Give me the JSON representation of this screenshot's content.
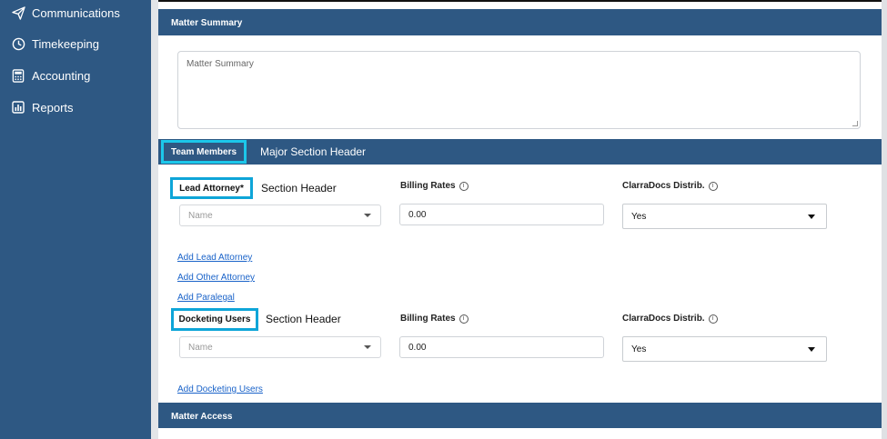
{
  "sidebar": {
    "items": [
      {
        "label": "Communications",
        "icon": "paper-plane-icon"
      },
      {
        "label": "Timekeeping",
        "icon": "clock-icon"
      },
      {
        "label": "Accounting",
        "icon": "calculator-icon"
      },
      {
        "label": "Reports",
        "icon": "bar-chart-icon"
      }
    ]
  },
  "matter_summary": {
    "title": "Matter Summary",
    "placeholder": "Matter Summary"
  },
  "team_members": {
    "title": "Team Members",
    "major_header": "Major Section Header",
    "lead": {
      "box_label": "Lead Attorney*",
      "section_header": "Section Header",
      "name_placeholder": "Name",
      "billing_label": "Billing Rates",
      "billing_value": "0.00",
      "distrib_label": "ClarraDocs Distrib.",
      "distrib_value": "Yes"
    },
    "links": [
      "Add Lead Attorney",
      "Add Other Attorney",
      "Add Paralegal"
    ],
    "docketing": {
      "box_label": "Docketing Users",
      "section_header": "Section Header",
      "name_placeholder": "Name",
      "billing_label": "Billing Rates",
      "billing_value": "0.00",
      "distrib_label": "ClarraDocs Distrib.",
      "distrib_value": "Yes"
    },
    "add_docketing": "Add Docketing Users"
  },
  "matter_access": {
    "title": "Matter Access"
  },
  "colors": {
    "sidebar_bg": "#2e5883",
    "bar_bg": "#2e5883",
    "highlight": "#0ea5d8",
    "link": "#1a63c9"
  }
}
